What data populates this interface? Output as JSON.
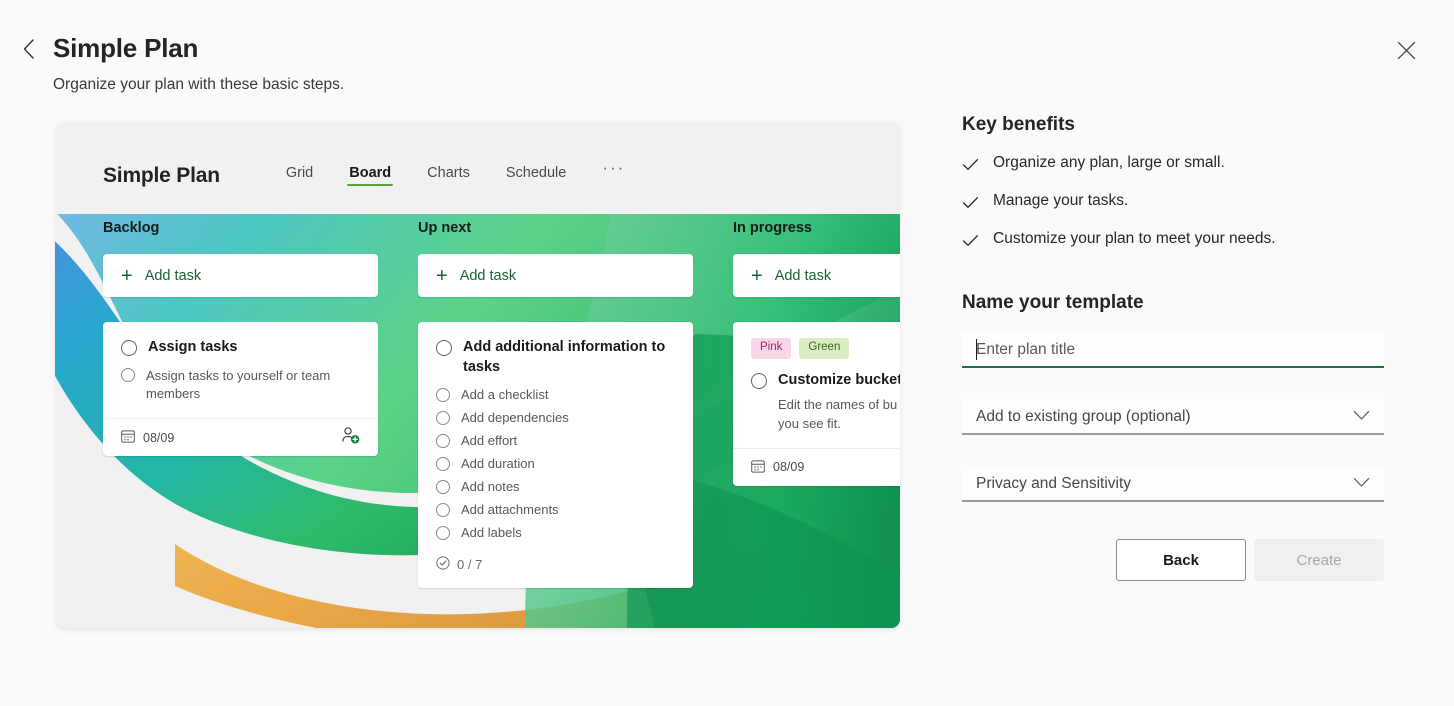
{
  "header": {
    "back_icon": "chevron-left-icon",
    "title": "Simple Plan",
    "subtitle": "Organize your plan with these basic steps.",
    "close_icon": "close-icon"
  },
  "preview": {
    "plan_name": "Simple Plan",
    "tabs": [
      {
        "label": "Grid",
        "active": false
      },
      {
        "label": "Board",
        "active": true
      },
      {
        "label": "Charts",
        "active": false
      },
      {
        "label": "Schedule",
        "active": false
      }
    ],
    "overflow_label": "···",
    "accent_green": "#5b9f3e",
    "add_task_label": "Add task",
    "columns": [
      {
        "title": "Backlog",
        "card": {
          "title": "Assign tasks",
          "subtitle": "Assign tasks to yourself or team members",
          "date": "08/09",
          "date_icon": "calendar-icon",
          "assign_icon": "person-add-icon"
        }
      },
      {
        "title": "Up next",
        "card": {
          "title": "Add additional information to tasks",
          "checklist": [
            "Add a checklist",
            "Add dependencies",
            "Add effort",
            "Add duration",
            "Add notes",
            "Add attachments",
            "Add labels"
          ],
          "progress": "0 / 7",
          "progress_icon": "checkmark-circle-icon"
        }
      },
      {
        "title": "In progress",
        "card": {
          "labels": [
            {
              "text": "Pink",
              "bg": "#f7d6e8",
              "fg": "#9b2c6a"
            },
            {
              "text": "Green",
              "bg": "#dcecc2",
              "fg": "#39621d"
            }
          ],
          "title": "Customize bucket",
          "subtitle": "Edit the names of bu fit your needs, and a as you see fit.",
          "date": "08/09",
          "date_icon": "calendar-icon"
        }
      }
    ]
  },
  "side": {
    "benefits_heading": "Key benefits",
    "benefits": [
      "Organize any plan, large or small.",
      "Manage your tasks.",
      "Customize your plan to meet your needs."
    ],
    "benefit_icon": "checkmark-icon",
    "form_heading": "Name your template",
    "plan_title_value": "",
    "plan_title_placeholder": "Enter plan title",
    "group_select_value": "Add to existing group (optional)",
    "privacy_select_value": "Privacy and Sensitivity",
    "chevron_icon": "chevron-down-icon",
    "back_label": "Back",
    "create_label": "Create",
    "focus_underline_color": "#1a7340"
  }
}
